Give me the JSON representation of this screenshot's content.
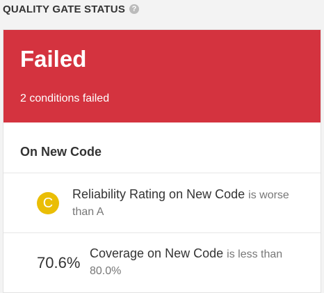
{
  "header": {
    "title": "QUALITY GATE STATUS",
    "help_glyph": "?",
    "help_icon": "help-icon"
  },
  "status": {
    "label": "Failed",
    "summary": "2 conditions failed",
    "color": "#d4333f"
  },
  "section": {
    "title": "On New Code"
  },
  "conditions": [
    {
      "rating": "C",
      "rating_color": "#eabe06",
      "metric": "Reliability Rating on New Code",
      "operator": "is worse",
      "threshold": "than A"
    },
    {
      "value": "70.6%",
      "metric": "Coverage on New Code",
      "operator": "is less than",
      "threshold": "80.0%"
    }
  ]
}
